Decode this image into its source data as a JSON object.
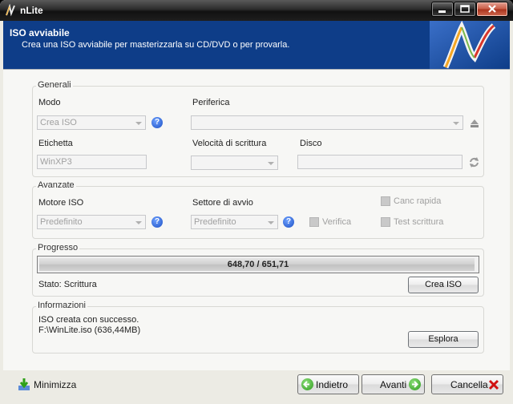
{
  "window": {
    "title": "nLite"
  },
  "header": {
    "title": "ISO avviabile",
    "subtitle": "Crea una ISO avviabile per masterizzarla su CD/DVD o per provarla."
  },
  "generali": {
    "legend": "Generali",
    "modo_label": "Modo",
    "modo_value": "Crea ISO",
    "periferica_label": "Periferica",
    "periferica_value": "",
    "etichetta_label": "Etichetta",
    "etichetta_value": "WinXP3",
    "velocita_label": "Velocità di scrittura",
    "velocita_value": "",
    "disco_label": "Disco",
    "disco_value": ""
  },
  "avanzate": {
    "legend": "Avanzate",
    "motore_label": "Motore ISO",
    "motore_value": "Predefinito",
    "settore_label": "Settore di avvio",
    "settore_value": "Predefinito",
    "canc_rapida": "Canc rapida",
    "verifica": "Verifica",
    "test_scrittura": "Test scrittura"
  },
  "progresso": {
    "legend": "Progresso",
    "progress_text": "648,70 / 651,71",
    "progress_fraction": 0.995,
    "status": "Stato: Scrittura",
    "crea_button": "Crea ISO"
  },
  "informazioni": {
    "legend": "Informazioni",
    "line1": "ISO creata con successo.",
    "line2": "F:\\WinLite.iso (636,44MB)",
    "esplora_button": "Esplora"
  },
  "footer": {
    "minimizza": "Minimizza",
    "indietro": "Indietro",
    "avanti": "Avanti",
    "cancella": "Cancella"
  },
  "help_glyph": "?",
  "colors": {
    "header_bg": "#0e3d88",
    "accent_green": "#2f9a1e",
    "cancel_red": "#d01010"
  }
}
